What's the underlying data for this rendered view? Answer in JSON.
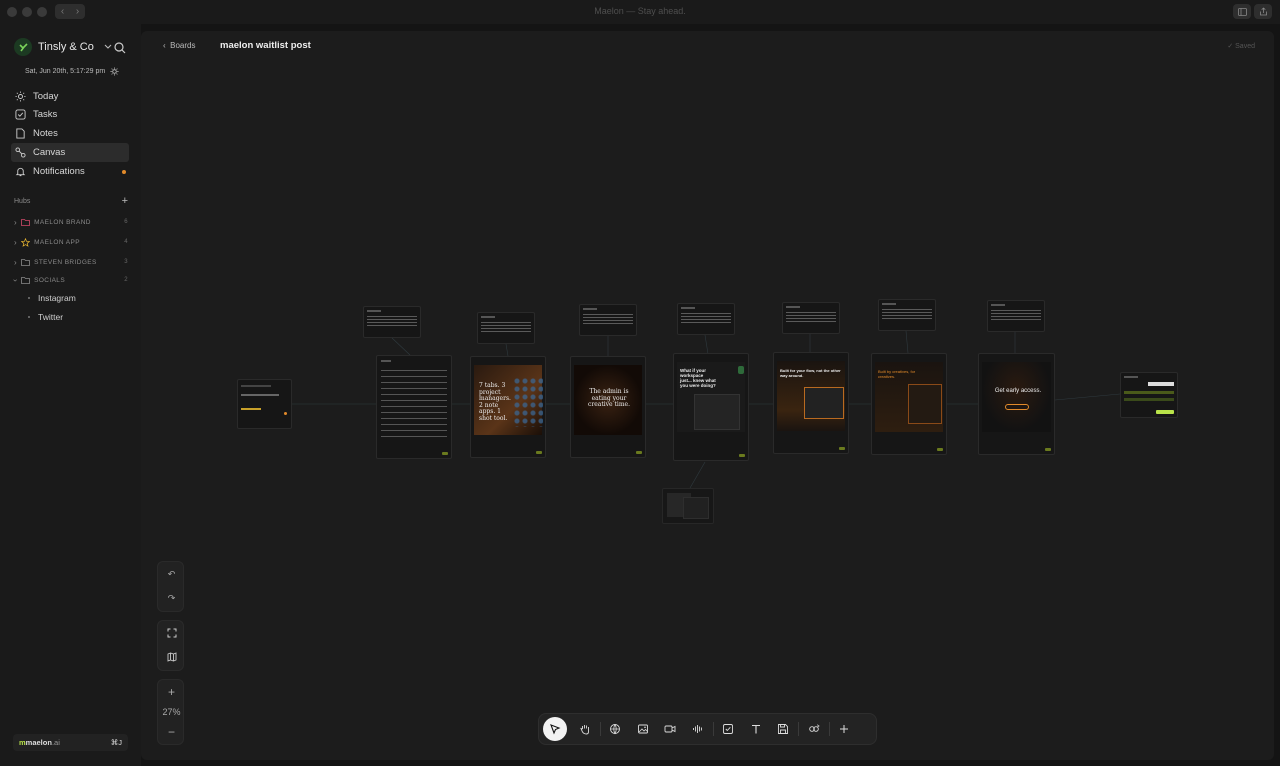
{
  "window": {
    "title": "Maelon — Stay ahead."
  },
  "workspace": {
    "name": "Tinsly & Co",
    "date": "Sat, Jun 20th, 5:17:29 pm"
  },
  "nav": [
    {
      "label": "Today",
      "icon": "sun-icon"
    },
    {
      "label": "Tasks",
      "icon": "checkbox-icon"
    },
    {
      "label": "Notes",
      "icon": "note-icon"
    },
    {
      "label": "Canvas",
      "icon": "canvas-icon",
      "active": true
    },
    {
      "label": "Notifications",
      "icon": "bell-icon",
      "dot": true
    }
  ],
  "hubs": {
    "title": "Hubs",
    "items": [
      {
        "label": "MAELON BRAND",
        "count": "6",
        "color": "#d04a6a"
      },
      {
        "label": "MAELON APP",
        "count": "4",
        "color": "#e0b030"
      },
      {
        "label": "STEVEN BRIDGES",
        "count": "3",
        "color": "#8a8a8a"
      },
      {
        "label": "SOCIALS",
        "count": "2",
        "color": "#8a8a8a"
      }
    ],
    "socials_children": [
      "Instagram",
      "Twitter"
    ]
  },
  "brand": {
    "name": "maelon",
    "suffix": ".ai",
    "shortcut": "⌘J"
  },
  "header": {
    "back_label": "Boards",
    "title": "maelon waitlist post",
    "saved": "Saved"
  },
  "canvas": {
    "zoom": "27%",
    "posts": [
      {
        "headline": "7 tabs. 3 project managers. 2 note apps. 1 shot tool."
      },
      {
        "headline": "The admin is eating your creative time."
      },
      {
        "headline": "What if your workspace just... knew what you were doing?"
      },
      {
        "headline": "Built for your flow, not the other way around."
      },
      {
        "headline": "Built by creatives, for creatives."
      },
      {
        "headline": "Get early access."
      }
    ]
  },
  "colors": {
    "accent_orange": "#e28a2a",
    "accent_lime": "#b9e34a",
    "brand_green": "#7ad35a"
  }
}
